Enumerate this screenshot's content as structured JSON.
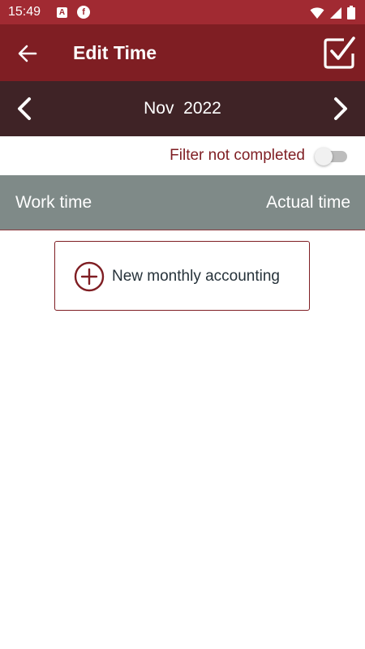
{
  "status_bar": {
    "time": "15:49",
    "notification_icons": [
      "app-a-icon",
      "app-f-icon"
    ],
    "system_icons": [
      "wifi-icon",
      "signal-icon",
      "battery-icon"
    ]
  },
  "app_bar": {
    "title": "Edit Time",
    "back_icon": "arrow-left-icon",
    "confirm_icon": "checkbox-checked-icon"
  },
  "month_selector": {
    "label": "Nov  2022",
    "prev_icon": "chevron-left-icon",
    "next_icon": "chevron-right-icon"
  },
  "filter": {
    "label": "Filter not completed",
    "enabled": false
  },
  "table_header": {
    "columns": [
      "Work time",
      "Actual time"
    ]
  },
  "actions": {
    "new_accounting_label": "New monthly accounting",
    "new_accounting_icon": "plus-circle-icon"
  },
  "colors": {
    "status_bar": "#a12a32",
    "app_bar": "#7f1e23",
    "month_bar": "#3f2326",
    "table_header": "#7f8a88",
    "accent": "#7f1e23"
  }
}
